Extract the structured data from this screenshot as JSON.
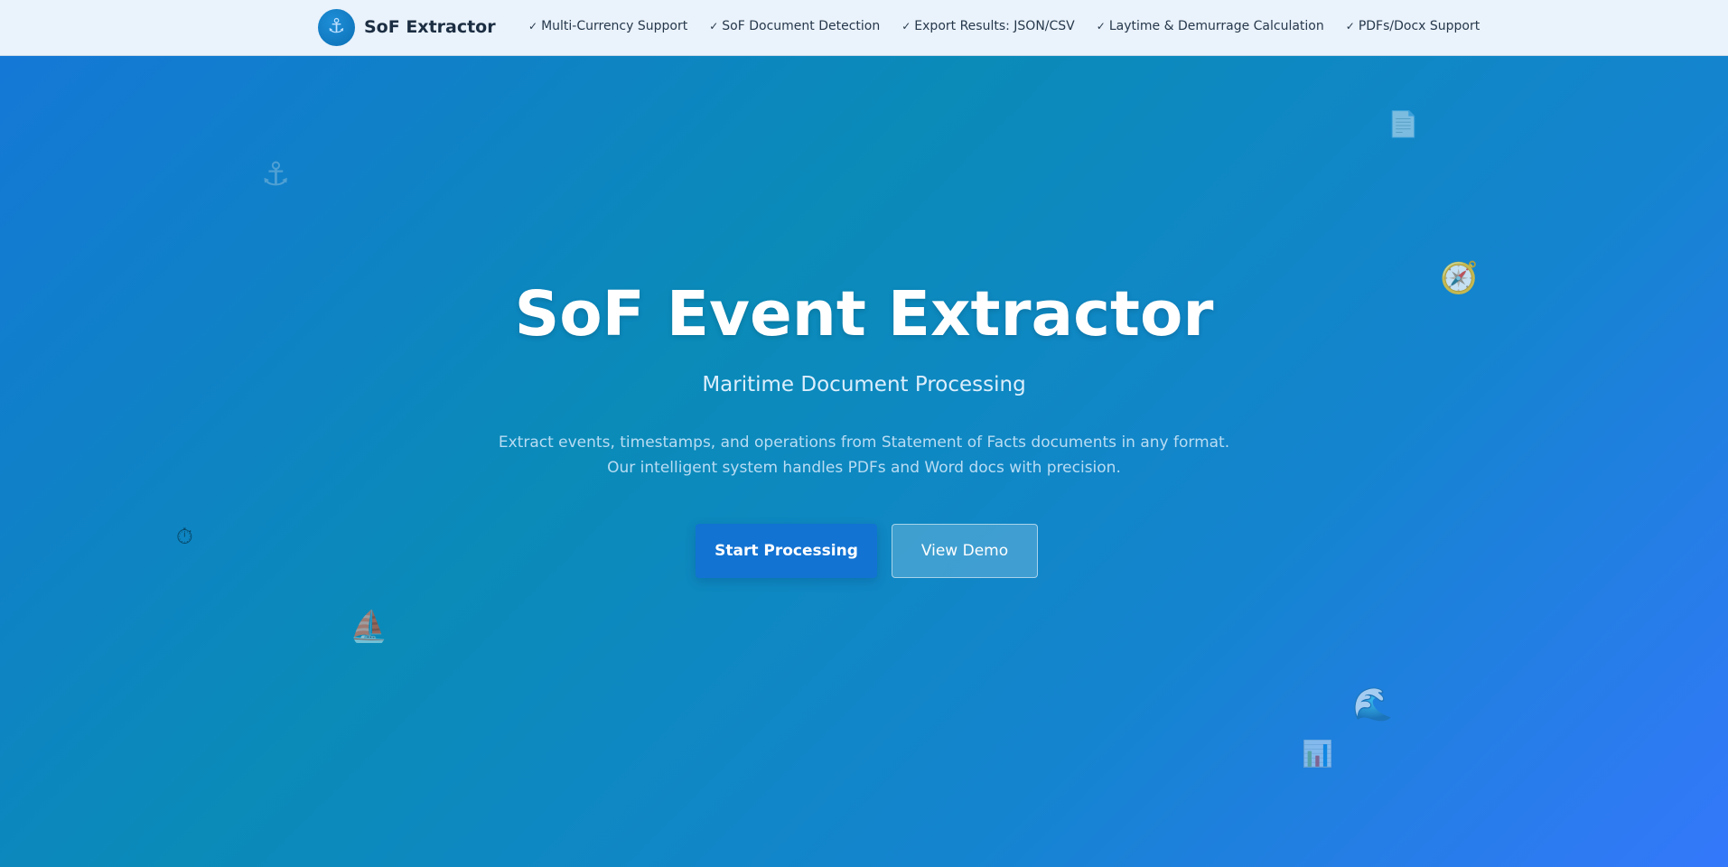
{
  "navbar": {
    "brand_icon": "anchor-icon",
    "brand_name": "SoF Extractor",
    "features": [
      {
        "check": "✓",
        "label": "Multi-Currency Support"
      },
      {
        "check": "✓",
        "label": "SoF Document Detection"
      },
      {
        "check": "✓",
        "label": "Export Results: JSON/CSV"
      },
      {
        "check": "✓",
        "label": "Laytime & Demurrage Calculation"
      },
      {
        "check": "✓",
        "label": "PDFs/Docx Support"
      }
    ]
  },
  "hero": {
    "title": "SoF Event Extractor",
    "subtitle": "Maritime Document Processing",
    "description_line1": "Extract events, timestamps, and operations from Statement of Facts documents in any format.",
    "description_line2": "Our intelligent system handles PDFs and Word docs with precision.",
    "primary_button": "Start Processing",
    "secondary_button": "View Demo"
  },
  "decorations": {
    "anchor": "⚓",
    "document": "📄",
    "compass": "🧭",
    "stopwatch": "⏱",
    "sailboat": "⛵",
    "wave": "🌊",
    "chart": "📊"
  },
  "colors": {
    "navbar_bg": "#eaf2fb",
    "hero_gradient_start": "#1577d8",
    "hero_gradient_end": "#3478fb",
    "primary_button": "#1273d3",
    "title_text": "#ffffff"
  }
}
